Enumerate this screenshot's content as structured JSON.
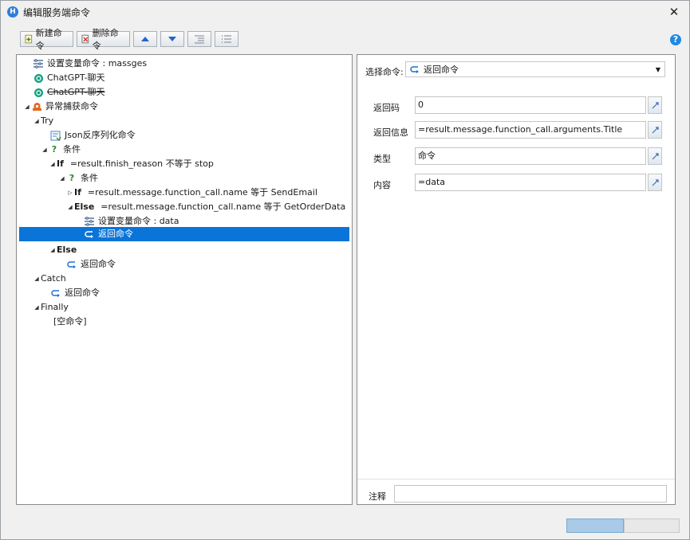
{
  "window": {
    "title": "编辑服务端命令",
    "app_icon_letter": "H",
    "close_glyph": "✕"
  },
  "toolbar": {
    "new_label": "新建命令",
    "delete_label": "删除命令",
    "help_glyph": "?"
  },
  "tree": {
    "nodes": [
      {
        "text": "设置变量命令 : massges"
      },
      {
        "text": "ChatGPT-聊天"
      },
      {
        "text": "ChatGPT-聊天"
      },
      {
        "text": "异常捕获命令"
      },
      {
        "text": "Try"
      },
      {
        "text": "Json反序列化命令"
      },
      {
        "text": "条件"
      },
      {
        "keyword": "If",
        "text": "=result.finish_reason 不等于 stop"
      },
      {
        "text": "条件"
      },
      {
        "keyword": "If",
        "text": "=result.message.function_call.name 等于 SendEmail"
      },
      {
        "keyword": "Else",
        "text": "=result.message.function_call.name 等于 GetOrderData"
      },
      {
        "text": "设置变量命令 : data"
      },
      {
        "text": "返回命令"
      },
      {
        "keyword": "Else"
      },
      {
        "text": "返回命令"
      },
      {
        "text": "Catch"
      },
      {
        "text": "返回命令"
      },
      {
        "text": "Finally"
      },
      {
        "text": "[空命令]"
      }
    ]
  },
  "details": {
    "select_label": "选择命令:",
    "select_value": "返回命令",
    "fields": [
      {
        "label": "返回码",
        "value": "0"
      },
      {
        "label": "返回信息",
        "value": "=result.message.function_call.arguments.Title"
      },
      {
        "label": "类型",
        "value": "命令"
      },
      {
        "label": "内容",
        "value": "=data"
      }
    ],
    "note_label": "注释",
    "note_value": ""
  },
  "colors": {
    "selection": "#0a74d8",
    "accent": "#2f7fd8"
  }
}
